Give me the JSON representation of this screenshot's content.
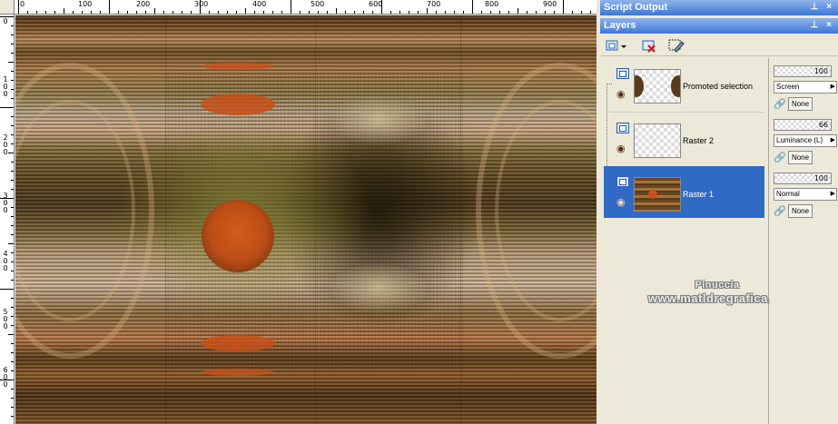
{
  "ruler": {
    "h_labels": [
      "0",
      "100",
      "200",
      "300",
      "400",
      "500",
      "600",
      "700",
      "800",
      "900"
    ],
    "v_labels": [
      "0",
      "1 0 0",
      "2 0 0",
      "3 0 0",
      "4 0 0",
      "5 0 0",
      "6 0 0"
    ]
  },
  "panels": {
    "script_output_title": "Script Output",
    "layers_title": "Layers",
    "pin_icon": "pin-icon",
    "close_icon": "close-icon"
  },
  "toolbar": {
    "new_layer_icon": "new-layer-icon",
    "delete_layer_icon": "delete-layer-icon",
    "edit_selection_icon": "edit-selection-icon"
  },
  "layers": [
    {
      "name": "Promoted selection",
      "opacity": "100",
      "blend": "Screen",
      "link": "None",
      "selected": false
    },
    {
      "name": "Raster 2",
      "opacity": "66",
      "blend": "Luminance (L)",
      "link": "None",
      "selected": false
    },
    {
      "name": "Raster 1",
      "opacity": "100",
      "blend": "Normal",
      "link": "None",
      "selected": true
    }
  ],
  "watermark": {
    "line1": "Pinuccia",
    "line2": "www.matldregrafica.eu"
  },
  "colors": {
    "titlebar": "#3d76d6",
    "selected_row": "#316ac5",
    "orange_circle": "#c8501a"
  }
}
